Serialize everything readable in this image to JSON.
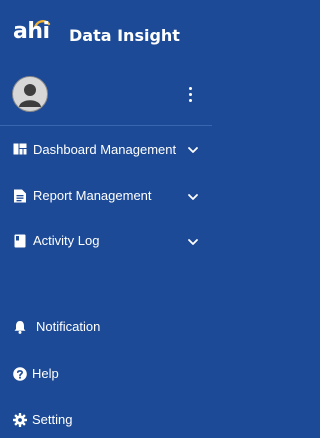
{
  "brand": {
    "logo_text": "ahi",
    "title": "Data Insight"
  },
  "user": {
    "avatar_icon": "user-avatar-icon",
    "menu_icon": "more-vertical-icon"
  },
  "nav": {
    "items": [
      {
        "label": "Dashboard Management",
        "icon": "dashboard-icon",
        "expandable": true
      },
      {
        "label": "Report Management",
        "icon": "report-icon",
        "expandable": true
      },
      {
        "label": "Activity Log",
        "icon": "book-icon",
        "expandable": true
      }
    ]
  },
  "bottom_nav": {
    "items": [
      {
        "label": "Notification",
        "icon": "bell-icon"
      },
      {
        "label": "Help",
        "icon": "help-icon"
      },
      {
        "label": "Setting",
        "icon": "gear-icon"
      }
    ]
  },
  "colors": {
    "background": "#1c4a96",
    "logo_arc": "#f2b233",
    "text": "#ffffff"
  }
}
